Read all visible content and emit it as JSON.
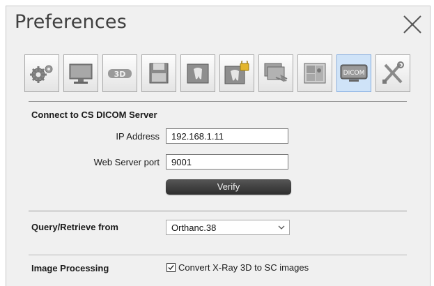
{
  "window": {
    "title": "Preferences"
  },
  "toolbar": {
    "active_color": "#cfe3f8",
    "items": [
      {
        "icon": "gears-icon"
      },
      {
        "icon": "monitor-icon"
      },
      {
        "icon": "3d-icon",
        "text": "3D"
      },
      {
        "icon": "save-disk-icon"
      },
      {
        "icon": "tooth-image-icon"
      },
      {
        "icon": "tooth-image-locked-icon"
      },
      {
        "icon": "export-images-icon"
      },
      {
        "icon": "patient-images-icon"
      },
      {
        "icon": "dicom-icon",
        "text": "DICOM",
        "active": true
      },
      {
        "icon": "tools-icon"
      }
    ]
  },
  "connect": {
    "heading": "Connect to CS DICOM Server",
    "ip_label": "IP Address",
    "ip_value": "192.168.1.11",
    "port_label": "Web Server port",
    "port_value": "9001",
    "verify_label": "Verify"
  },
  "query": {
    "heading": "Query/Retrieve from",
    "selected": "Orthanc.38"
  },
  "processing": {
    "heading": "Image Processing",
    "checkbox_label": "Convert X-Ray 3D to SC images",
    "checked": true
  }
}
